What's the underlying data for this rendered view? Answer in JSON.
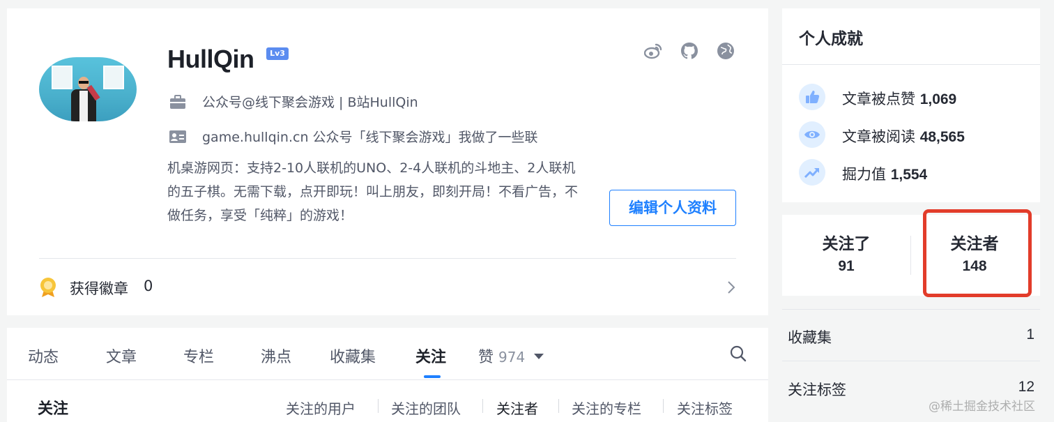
{
  "profile": {
    "username": "HullQin",
    "level": "Lv3",
    "job": "公众号@线下聚会游戏 | B站HullQin",
    "bio_first": "game.hullqin.cn 公众号「线下聚会游戏」我做了一些联",
    "bio_rest": "机桌游网页：支持2-10人联机的UNO、2-4人联机的斗地主、2人联机的五子棋。无需下载，点开即玩！叫上朋友，即刻开局！不看广告，不做任务，享受「纯粹」的游戏！",
    "edit_button": "编辑个人资料",
    "badges_label": "获得徽章",
    "badges_count": "0",
    "social_icons": [
      "weibo-icon",
      "github-icon",
      "globe-icon"
    ]
  },
  "tabs": {
    "items": [
      "动态",
      "文章",
      "专栏",
      "沸点",
      "收藏集",
      "关注",
      "赞"
    ],
    "zan_count": "974",
    "active": "关注",
    "sub_title": "关注",
    "subtabs": [
      "关注的用户",
      "关注的团队",
      "关注者",
      "关注的专栏",
      "关注标签"
    ],
    "active_subtab": "关注者"
  },
  "achievements": {
    "title": "个人成就",
    "items": [
      {
        "label": "文章被点赞",
        "value": "1,069",
        "icon": "thumbs-up-icon"
      },
      {
        "label": "文章被阅读",
        "value": "48,565",
        "icon": "eye-icon"
      },
      {
        "label": "掘力值",
        "value": "1,554",
        "icon": "trend-up-icon"
      }
    ]
  },
  "follow": {
    "following_label": "关注了",
    "following_count": "91",
    "followers_label": "关注者",
    "followers_count": "148"
  },
  "lists": [
    {
      "label": "收藏集",
      "count": "1"
    },
    {
      "label": "关注标签",
      "count": "12"
    }
  ],
  "watermark": "@稀土掘金技术社区",
  "colors": {
    "accent": "#1e80ff",
    "highlight": "#e23c2a",
    "text": "#252933",
    "muted": "#515767"
  }
}
